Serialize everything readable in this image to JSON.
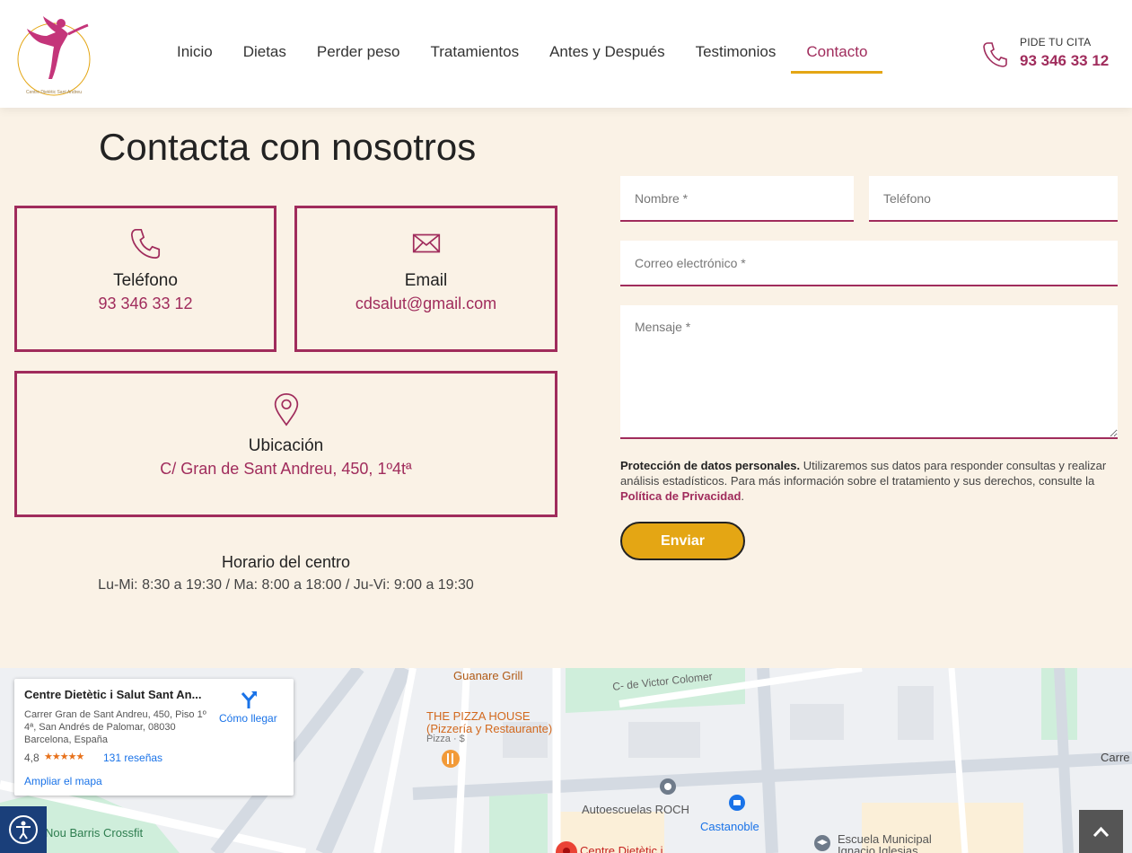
{
  "header": {
    "logo_icon": "dancer-logo-icon",
    "nav": [
      {
        "label": "Inicio"
      },
      {
        "label": "Dietas"
      },
      {
        "label": "Perder peso"
      },
      {
        "label": "Tratamientos"
      },
      {
        "label": "Antes y Después"
      },
      {
        "label": "Testimonios"
      },
      {
        "label": "Contacto",
        "active": true
      }
    ],
    "cta_label": "PIDE TU CITA",
    "cta_phone": "93 346 33 12"
  },
  "main": {
    "title": "Contacta con nosotros",
    "cards": {
      "phone": {
        "icon": "phone-icon",
        "title": "Teléfono",
        "value": "93 346 33 12"
      },
      "email": {
        "icon": "envelope-icon",
        "title": "Email",
        "value": "cdsalut@gmail.com"
      },
      "location": {
        "icon": "map-pin-icon",
        "title": "Ubicación",
        "value": "C/ Gran de Sant Andreu, 450, 1º4tª"
      }
    },
    "hours": {
      "title": "Horario del centro",
      "text": "Lu-Mi: 8:30 a 19:30 / Ma: 8:00 a 18:00 / Ju-Vi: 9:00 a 19:30"
    }
  },
  "form": {
    "name_placeholder": "Nombre *",
    "phone_placeholder": "Teléfono",
    "email_placeholder": "Correo electrónico *",
    "message_placeholder": "Mensaje *",
    "privacy_bold": "Protección de datos personales.",
    "privacy_text": " Utilizaremos sus datos para responder consultas y realizar análisis estadísticos. Para más información sobre el tratamiento y sus derechos, consulte la ",
    "privacy_link": "Política de Privacidad",
    "privacy_end": ".",
    "submit_label": "Enviar"
  },
  "map": {
    "place_name": "Centre Dietètic i Salut Sant An...",
    "address": "Carrer Gran de Sant Andreu, 450, Piso 1º 4ª, San Andrés de Palomar, 08030 Barcelona, España",
    "rating": "4,8",
    "stars": "★★★★★",
    "reviews": "131 reseñas",
    "enlarge": "Ampliar el mapa",
    "directions": "Cómo llegar",
    "labels": {
      "guanare": "Guanare Grill",
      "victor": "C- de Victor Colomer",
      "pizza_house": "THE PIZZA HOUSE",
      "pizza_sub": "(Pizzería y Restaurante)",
      "pizza_cat": "Pizza · $",
      "autoescuelas": "Autoescuelas ROCH",
      "castanoble": "Castanoble",
      "escuela": "Escuela Municipal",
      "ignacio": "Ignacio Iglesias",
      "crossfit": "Nou Barris Crossfit",
      "centre": "Centre Dietètic i",
      "carrer": "Carre"
    }
  },
  "widgets": {
    "accessibility_icon": "accessibility-icon",
    "scroll_top_icon": "chevron-up-icon"
  }
}
